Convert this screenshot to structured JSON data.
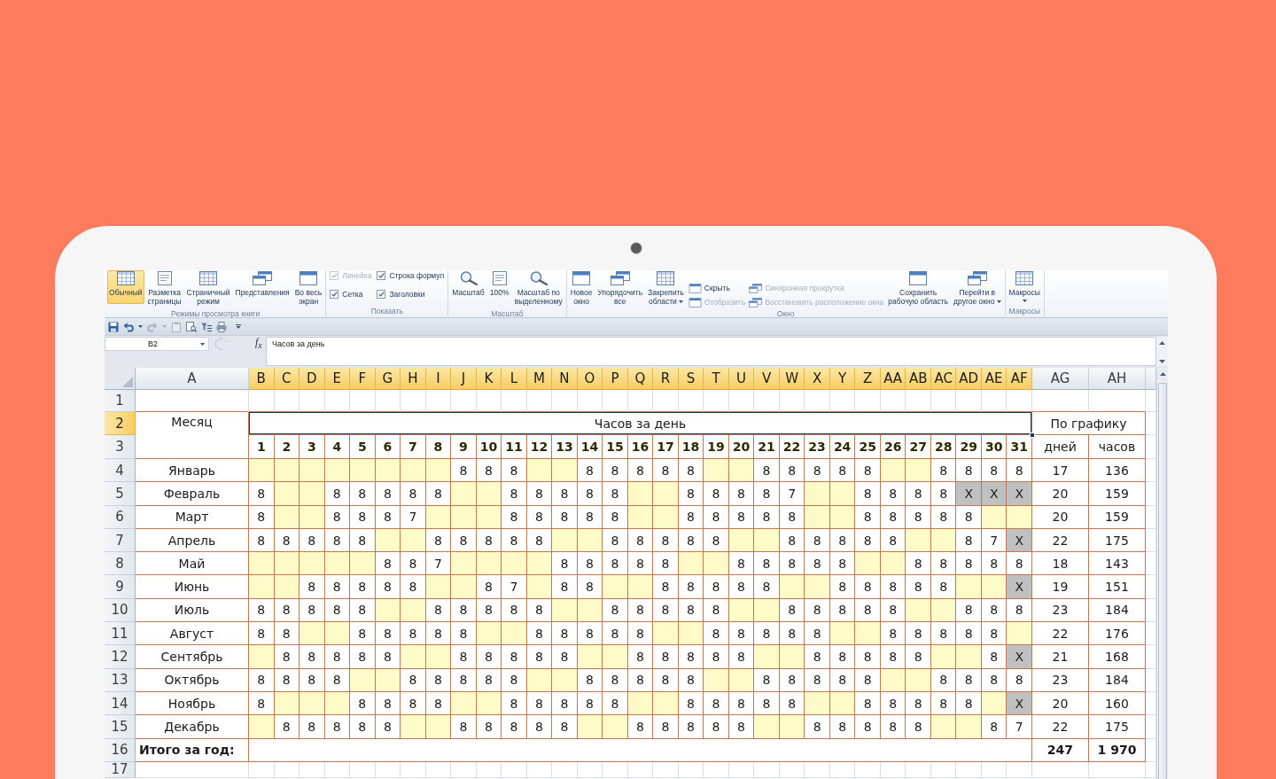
{
  "ribbon": {
    "groups": [
      {
        "label": "Режимы просмотра книги",
        "items": [
          {
            "kind": "large",
            "label": "Обычный",
            "selected": true,
            "disabled": false,
            "menu": false
          },
          {
            "kind": "large",
            "label": "Разметка\nстраницы",
            "selected": false,
            "disabled": false,
            "menu": false
          },
          {
            "kind": "large",
            "label": "Страничный\nрежим",
            "selected": false,
            "disabled": false,
            "menu": false
          },
          {
            "kind": "large",
            "label": "Представления",
            "selected": false,
            "disabled": false,
            "menu": false
          },
          {
            "kind": "large",
            "label": "Во весь\nэкран",
            "selected": false,
            "disabled": false,
            "menu": false
          }
        ]
      },
      {
        "label": "Показать",
        "items": [
          {
            "kind": "check",
            "label": "Линейка",
            "checked": true,
            "disabled": true
          },
          {
            "kind": "check",
            "label": "Сетка",
            "checked": true,
            "disabled": false
          },
          {
            "kind": "check",
            "label": "Строка формул",
            "checked": true,
            "disabled": false
          },
          {
            "kind": "check",
            "label": "Заголовки",
            "checked": true,
            "disabled": false
          }
        ]
      },
      {
        "label": "Масштаб",
        "items": [
          {
            "kind": "large",
            "label": "Масштаб",
            "disabled": false,
            "menu": false
          },
          {
            "kind": "large",
            "label": "100%",
            "disabled": false,
            "menu": false
          },
          {
            "kind": "large",
            "label": "Масштаб по\nвыделенному",
            "disabled": false,
            "menu": false
          }
        ]
      },
      {
        "label": "Окно",
        "items": [
          {
            "kind": "large",
            "label": "Новое\nокно",
            "disabled": false,
            "menu": false
          },
          {
            "kind": "large",
            "label": "Упорядочить\nвсе",
            "disabled": false,
            "menu": false
          },
          {
            "kind": "large",
            "label": "Закрепить\nобласти",
            "disabled": false,
            "menu": true
          },
          {
            "kind": "small",
            "label": "Скрыть",
            "disabled": false
          },
          {
            "kind": "small",
            "label": "Отобразить",
            "disabled": true
          },
          {
            "kind": "small",
            "label": "Синхронная прокрутка",
            "disabled": true
          },
          {
            "kind": "small",
            "label": "Восстановить расположение окна",
            "disabled": true
          },
          {
            "kind": "large",
            "label": "Сохранить\nрабочую область",
            "disabled": false,
            "menu": false
          },
          {
            "kind": "large",
            "label": "Перейти в\nдругое окно",
            "disabled": false,
            "menu": true
          }
        ]
      },
      {
        "label": "Макросы",
        "items": [
          {
            "kind": "large",
            "label": "Макросы",
            "disabled": false,
            "menu": true
          }
        ]
      }
    ]
  },
  "formula_bar": {
    "name_box": "B2",
    "function_button": "f$_{x}$",
    "formula": "Часов за день"
  },
  "sheet": {
    "columns": [
      {
        "label": "A",
        "selected": false
      },
      {
        "label": "B",
        "selected": true
      },
      {
        "label": "C",
        "selected": true
      },
      {
        "label": "D",
        "selected": true
      },
      {
        "label": "E",
        "selected": true
      },
      {
        "label": "F",
        "selected": true
      },
      {
        "label": "G",
        "selected": true
      },
      {
        "label": "H",
        "selected": true
      },
      {
        "label": "I",
        "selected": true
      },
      {
        "label": "J",
        "selected": true
      },
      {
        "label": "K",
        "selected": true
      },
      {
        "label": "L",
        "selected": true
      },
      {
        "label": "M",
        "selected": true
      },
      {
        "label": "N",
        "selected": true
      },
      {
        "label": "O",
        "selected": true
      },
      {
        "label": "P",
        "selected": true
      },
      {
        "label": "Q",
        "selected": true
      },
      {
        "label": "R",
        "selected": true
      },
      {
        "label": "S",
        "selected": true
      },
      {
        "label": "T",
        "selected": true
      },
      {
        "label": "U",
        "selected": true
      },
      {
        "label": "V",
        "selected": true
      },
      {
        "label": "W",
        "selected": true
      },
      {
        "label": "X",
        "selected": true
      },
      {
        "label": "Y",
        "selected": true
      },
      {
        "label": "Z",
        "selected": true
      },
      {
        "label": "AA",
        "selected": true
      },
      {
        "label": "AB",
        "selected": true
      },
      {
        "label": "AC",
        "selected": true
      },
      {
        "label": "AD",
        "selected": true
      },
      {
        "label": "AE",
        "selected": true
      },
      {
        "label": "AF",
        "selected": true
      },
      {
        "label": "AG",
        "selected": false
      },
      {
        "label": "AH",
        "selected": false
      }
    ],
    "rows": [
      {
        "label": "1",
        "selected": false
      },
      {
        "label": "2",
        "selected": true
      },
      {
        "label": "3",
        "selected": false
      },
      {
        "label": "4",
        "selected": false
      },
      {
        "label": "5",
        "selected": false
      },
      {
        "label": "6",
        "selected": false
      },
      {
        "label": "7",
        "selected": false
      },
      {
        "label": "8",
        "selected": false
      },
      {
        "label": "9",
        "selected": false
      },
      {
        "label": "10",
        "selected": false
      },
      {
        "label": "11",
        "selected": false
      },
      {
        "label": "12",
        "selected": false
      },
      {
        "label": "13",
        "selected": false
      },
      {
        "label": "14",
        "selected": false
      },
      {
        "label": "15",
        "selected": false
      },
      {
        "label": "16",
        "selected": false
      },
      {
        "label": "17",
        "selected": false
      }
    ],
    "title_cells": [
      {
        "text": "Месяц",
        "selected": false
      },
      {
        "text": "Часов за день",
        "selected": true
      },
      {
        "text": "По графику",
        "selected": false
      }
    ],
    "day_numbers": [
      "1",
      "2",
      "3",
      "4",
      "5",
      "6",
      "7",
      "8",
      "9",
      "10",
      "11",
      "12",
      "13",
      "14",
      "15",
      "16",
      "17",
      "18",
      "19",
      "20",
      "21",
      "22",
      "23",
      "24",
      "25",
      "26",
      "27",
      "28",
      "29",
      "30",
      "31"
    ],
    "schedule_columns": [
      "дней",
      "часов"
    ],
    "months": [
      {
        "name": "Январь",
        "days_total": "17",
        "hours_total": "136",
        "days": [
          {
            "kind": "weekend"
          },
          {
            "kind": "weekend"
          },
          {
            "kind": "weekend"
          },
          {
            "kind": "weekend"
          },
          {
            "kind": "weekend"
          },
          {
            "kind": "weekend"
          },
          {
            "kind": "weekend"
          },
          {
            "kind": "weekend"
          },
          {
            "kind": "work",
            "value": "8"
          },
          {
            "kind": "work",
            "value": "8"
          },
          {
            "kind": "work",
            "value": "8"
          },
          {
            "kind": "weekend"
          },
          {
            "kind": "weekend"
          },
          {
            "kind": "work",
            "value": "8"
          },
          {
            "kind": "work",
            "value": "8"
          },
          {
            "kind": "work",
            "value": "8"
          },
          {
            "kind": "work",
            "value": "8"
          },
          {
            "kind": "work",
            "value": "8"
          },
          {
            "kind": "weekend"
          },
          {
            "kind": "weekend"
          },
          {
            "kind": "work",
            "value": "8"
          },
          {
            "kind": "work",
            "value": "8"
          },
          {
            "kind": "work",
            "value": "8"
          },
          {
            "kind": "work",
            "value": "8"
          },
          {
            "kind": "work",
            "value": "8"
          },
          {
            "kind": "weekend"
          },
          {
            "kind": "weekend"
          },
          {
            "kind": "work",
            "value": "8"
          },
          {
            "kind": "work",
            "value": "8"
          },
          {
            "kind": "work",
            "value": "8"
          },
          {
            "kind": "work",
            "value": "8"
          }
        ]
      },
      {
        "name": "Февраль",
        "days_total": "20",
        "hours_total": "159",
        "days": [
          {
            "kind": "work",
            "value": "8"
          },
          {
            "kind": "weekend"
          },
          {
            "kind": "weekend"
          },
          {
            "kind": "work",
            "value": "8"
          },
          {
            "kind": "work",
            "value": "8"
          },
          {
            "kind": "work",
            "value": "8"
          },
          {
            "kind": "work",
            "value": "8"
          },
          {
            "kind": "work",
            "value": "8"
          },
          {
            "kind": "weekend"
          },
          {
            "kind": "weekend"
          },
          {
            "kind": "work",
            "value": "8"
          },
          {
            "kind": "work",
            "value": "8"
          },
          {
            "kind": "work",
            "value": "8"
          },
          {
            "kind": "work",
            "value": "8"
          },
          {
            "kind": "work",
            "value": "8"
          },
          {
            "kind": "weekend"
          },
          {
            "kind": "weekend"
          },
          {
            "kind": "work",
            "value": "8"
          },
          {
            "kind": "work",
            "value": "8"
          },
          {
            "kind": "work",
            "value": "8"
          },
          {
            "kind": "work",
            "value": "8"
          },
          {
            "kind": "work",
            "value": "7"
          },
          {
            "kind": "weekend"
          },
          {
            "kind": "weekend"
          },
          {
            "kind": "work",
            "value": "8"
          },
          {
            "kind": "work",
            "value": "8"
          },
          {
            "kind": "work",
            "value": "8"
          },
          {
            "kind": "work",
            "value": "8"
          },
          {
            "kind": "void",
            "value": "X"
          },
          {
            "kind": "void",
            "value": "X"
          },
          {
            "kind": "void",
            "value": "X"
          }
        ]
      },
      {
        "name": "Март",
        "days_total": "20",
        "hours_total": "159",
        "days": [
          {
            "kind": "work",
            "value": "8"
          },
          {
            "kind": "weekend"
          },
          {
            "kind": "weekend"
          },
          {
            "kind": "work",
            "value": "8"
          },
          {
            "kind": "work",
            "value": "8"
          },
          {
            "kind": "work",
            "value": "8"
          },
          {
            "kind": "work",
            "value": "7"
          },
          {
            "kind": "weekend"
          },
          {
            "kind": "weekend"
          },
          {
            "kind": "weekend"
          },
          {
            "kind": "work",
            "value": "8"
          },
          {
            "kind": "work",
            "value": "8"
          },
          {
            "kind": "work",
            "value": "8"
          },
          {
            "kind": "work",
            "value": "8"
          },
          {
            "kind": "work",
            "value": "8"
          },
          {
            "kind": "weekend"
          },
          {
            "kind": "weekend"
          },
          {
            "kind": "work",
            "value": "8"
          },
          {
            "kind": "work",
            "value": "8"
          },
          {
            "kind": "work",
            "value": "8"
          },
          {
            "kind": "work",
            "value": "8"
          },
          {
            "kind": "work",
            "value": "8"
          },
          {
            "kind": "weekend"
          },
          {
            "kind": "weekend"
          },
          {
            "kind": "work",
            "value": "8"
          },
          {
            "kind": "work",
            "value": "8"
          },
          {
            "kind": "work",
            "value": "8"
          },
          {
            "kind": "work",
            "value": "8"
          },
          {
            "kind": "work",
            "value": "8"
          },
          {
            "kind": "weekend"
          },
          {
            "kind": "weekend"
          }
        ]
      },
      {
        "name": "Апрель",
        "days_total": "22",
        "hours_total": "175",
        "days": [
          {
            "kind": "work",
            "value": "8"
          },
          {
            "kind": "work",
            "value": "8"
          },
          {
            "kind": "work",
            "value": "8"
          },
          {
            "kind": "work",
            "value": "8"
          },
          {
            "kind": "work",
            "value": "8"
          },
          {
            "kind": "weekend"
          },
          {
            "kind": "weekend"
          },
          {
            "kind": "work",
            "value": "8"
          },
          {
            "kind": "work",
            "value": "8"
          },
          {
            "kind": "work",
            "value": "8"
          },
          {
            "kind": "work",
            "value": "8"
          },
          {
            "kind": "work",
            "value": "8"
          },
          {
            "kind": "weekend"
          },
          {
            "kind": "weekend"
          },
          {
            "kind": "work",
            "value": "8"
          },
          {
            "kind": "work",
            "value": "8"
          },
          {
            "kind": "work",
            "value": "8"
          },
          {
            "kind": "work",
            "value": "8"
          },
          {
            "kind": "work",
            "value": "8"
          },
          {
            "kind": "weekend"
          },
          {
            "kind": "weekend"
          },
          {
            "kind": "work",
            "value": "8"
          },
          {
            "kind": "work",
            "value": "8"
          },
          {
            "kind": "work",
            "value": "8"
          },
          {
            "kind": "work",
            "value": "8"
          },
          {
            "kind": "work",
            "value": "8"
          },
          {
            "kind": "weekend"
          },
          {
            "kind": "weekend"
          },
          {
            "kind": "work",
            "value": "8"
          },
          {
            "kind": "work",
            "value": "7"
          },
          {
            "kind": "void",
            "value": "X"
          }
        ]
      },
      {
        "name": "Май",
        "days_total": "18",
        "hours_total": "143",
        "days": [
          {
            "kind": "weekend"
          },
          {
            "kind": "weekend"
          },
          {
            "kind": "weekend"
          },
          {
            "kind": "weekend"
          },
          {
            "kind": "weekend"
          },
          {
            "kind": "work",
            "value": "8"
          },
          {
            "kind": "work",
            "value": "8"
          },
          {
            "kind": "work",
            "value": "7"
          },
          {
            "kind": "weekend"
          },
          {
            "kind": "weekend"
          },
          {
            "kind": "weekend"
          },
          {
            "kind": "weekend"
          },
          {
            "kind": "work",
            "value": "8"
          },
          {
            "kind": "work",
            "value": "8"
          },
          {
            "kind": "work",
            "value": "8"
          },
          {
            "kind": "work",
            "value": "8"
          },
          {
            "kind": "work",
            "value": "8"
          },
          {
            "kind": "weekend"
          },
          {
            "kind": "weekend"
          },
          {
            "kind": "work",
            "value": "8"
          },
          {
            "kind": "work",
            "value": "8"
          },
          {
            "kind": "work",
            "value": "8"
          },
          {
            "kind": "work",
            "value": "8"
          },
          {
            "kind": "work",
            "value": "8"
          },
          {
            "kind": "weekend"
          },
          {
            "kind": "weekend"
          },
          {
            "kind": "work",
            "value": "8"
          },
          {
            "kind": "work",
            "value": "8"
          },
          {
            "kind": "work",
            "value": "8"
          },
          {
            "kind": "work",
            "value": "8"
          },
          {
            "kind": "work",
            "value": "8"
          }
        ]
      },
      {
        "name": "Июнь",
        "days_total": "19",
        "hours_total": "151",
        "days": [
          {
            "kind": "weekend"
          },
          {
            "kind": "weekend"
          },
          {
            "kind": "work",
            "value": "8"
          },
          {
            "kind": "work",
            "value": "8"
          },
          {
            "kind": "work",
            "value": "8"
          },
          {
            "kind": "work",
            "value": "8"
          },
          {
            "kind": "work",
            "value": "8"
          },
          {
            "kind": "weekend"
          },
          {
            "kind": "weekend"
          },
          {
            "kind": "work",
            "value": "8"
          },
          {
            "kind": "work",
            "value": "7"
          },
          {
            "kind": "weekend"
          },
          {
            "kind": "work",
            "value": "8"
          },
          {
            "kind": "work",
            "value": "8"
          },
          {
            "kind": "weekend"
          },
          {
            "kind": "weekend"
          },
          {
            "kind": "work",
            "value": "8"
          },
          {
            "kind": "work",
            "value": "8"
          },
          {
            "kind": "work",
            "value": "8"
          },
          {
            "kind": "work",
            "value": "8"
          },
          {
            "kind": "work",
            "value": "8"
          },
          {
            "kind": "weekend"
          },
          {
            "kind": "weekend"
          },
          {
            "kind": "work",
            "value": "8"
          },
          {
            "kind": "work",
            "value": "8"
          },
          {
            "kind": "work",
            "value": "8"
          },
          {
            "kind": "work",
            "value": "8"
          },
          {
            "kind": "work",
            "value": "8"
          },
          {
            "kind": "weekend"
          },
          {
            "kind": "weekend"
          },
          {
            "kind": "void",
            "value": "X"
          }
        ]
      },
      {
        "name": "Июль",
        "days_total": "23",
        "hours_total": "184",
        "days": [
          {
            "kind": "work",
            "value": "8"
          },
          {
            "kind": "work",
            "value": "8"
          },
          {
            "kind": "work",
            "value": "8"
          },
          {
            "kind": "work",
            "value": "8"
          },
          {
            "kind": "work",
            "value": "8"
          },
          {
            "kind": "weekend"
          },
          {
            "kind": "weekend"
          },
          {
            "kind": "work",
            "value": "8"
          },
          {
            "kind": "work",
            "value": "8"
          },
          {
            "kind": "work",
            "value": "8"
          },
          {
            "kind": "work",
            "value": "8"
          },
          {
            "kind": "work",
            "value": "8"
          },
          {
            "kind": "weekend"
          },
          {
            "kind": "weekend"
          },
          {
            "kind": "work",
            "value": "8"
          },
          {
            "kind": "work",
            "value": "8"
          },
          {
            "kind": "work",
            "value": "8"
          },
          {
            "kind": "work",
            "value": "8"
          },
          {
            "kind": "work",
            "value": "8"
          },
          {
            "kind": "weekend"
          },
          {
            "kind": "weekend"
          },
          {
            "kind": "work",
            "value": "8"
          },
          {
            "kind": "work",
            "value": "8"
          },
          {
            "kind": "work",
            "value": "8"
          },
          {
            "kind": "work",
            "value": "8"
          },
          {
            "kind": "work",
            "value": "8"
          },
          {
            "kind": "weekend"
          },
          {
            "kind": "weekend"
          },
          {
            "kind": "work",
            "value": "8"
          },
          {
            "kind": "work",
            "value": "8"
          },
          {
            "kind": "work",
            "value": "8"
          }
        ]
      },
      {
        "name": "Август",
        "days_total": "22",
        "hours_total": "176",
        "days": [
          {
            "kind": "work",
            "value": "8"
          },
          {
            "kind": "work",
            "value": "8"
          },
          {
            "kind": "weekend"
          },
          {
            "kind": "weekend"
          },
          {
            "kind": "work",
            "value": "8"
          },
          {
            "kind": "work",
            "value": "8"
          },
          {
            "kind": "work",
            "value": "8"
          },
          {
            "kind": "work",
            "value": "8"
          },
          {
            "kind": "work",
            "value": "8"
          },
          {
            "kind": "weekend"
          },
          {
            "kind": "weekend"
          },
          {
            "kind": "work",
            "value": "8"
          },
          {
            "kind": "work",
            "value": "8"
          },
          {
            "kind": "work",
            "value": "8"
          },
          {
            "kind": "work",
            "value": "8"
          },
          {
            "kind": "work",
            "value": "8"
          },
          {
            "kind": "weekend"
          },
          {
            "kind": "weekend"
          },
          {
            "kind": "work",
            "value": "8"
          },
          {
            "kind": "work",
            "value": "8"
          },
          {
            "kind": "work",
            "value": "8"
          },
          {
            "kind": "work",
            "value": "8"
          },
          {
            "kind": "work",
            "value": "8"
          },
          {
            "kind": "weekend"
          },
          {
            "kind": "weekend"
          },
          {
            "kind": "work",
            "value": "8"
          },
          {
            "kind": "work",
            "value": "8"
          },
          {
            "kind": "work",
            "value": "8"
          },
          {
            "kind": "work",
            "value": "8"
          },
          {
            "kind": "work",
            "value": "8"
          },
          {
            "kind": "weekend"
          }
        ]
      },
      {
        "name": "Сентябрь",
        "days_total": "21",
        "hours_total": "168",
        "days": [
          {
            "kind": "weekend"
          },
          {
            "kind": "work",
            "value": "8"
          },
          {
            "kind": "work",
            "value": "8"
          },
          {
            "kind": "work",
            "value": "8"
          },
          {
            "kind": "work",
            "value": "8"
          },
          {
            "kind": "work",
            "value": "8"
          },
          {
            "kind": "weekend"
          },
          {
            "kind": "weekend"
          },
          {
            "kind": "work",
            "value": "8"
          },
          {
            "kind": "work",
            "value": "8"
          },
          {
            "kind": "work",
            "value": "8"
          },
          {
            "kind": "work",
            "value": "8"
          },
          {
            "kind": "work",
            "value": "8"
          },
          {
            "kind": "weekend"
          },
          {
            "kind": "weekend"
          },
          {
            "kind": "work",
            "value": "8"
          },
          {
            "kind": "work",
            "value": "8"
          },
          {
            "kind": "work",
            "value": "8"
          },
          {
            "kind": "work",
            "value": "8"
          },
          {
            "kind": "work",
            "value": "8"
          },
          {
            "kind": "weekend"
          },
          {
            "kind": "weekend"
          },
          {
            "kind": "work",
            "value": "8"
          },
          {
            "kind": "work",
            "value": "8"
          },
          {
            "kind": "work",
            "value": "8"
          },
          {
            "kind": "work",
            "value": "8"
          },
          {
            "kind": "work",
            "value": "8"
          },
          {
            "kind": "weekend"
          },
          {
            "kind": "weekend"
          },
          {
            "kind": "work",
            "value": "8"
          },
          {
            "kind": "void",
            "value": "X"
          }
        ]
      },
      {
        "name": "Октябрь",
        "days_total": "23",
        "hours_total": "184",
        "days": [
          {
            "kind": "work",
            "value": "8"
          },
          {
            "kind": "work",
            "value": "8"
          },
          {
            "kind": "work",
            "value": "8"
          },
          {
            "kind": "work",
            "value": "8"
          },
          {
            "kind": "weekend"
          },
          {
            "kind": "weekend"
          },
          {
            "kind": "work",
            "value": "8"
          },
          {
            "kind": "work",
            "value": "8"
          },
          {
            "kind": "work",
            "value": "8"
          },
          {
            "kind": "work",
            "value": "8"
          },
          {
            "kind": "work",
            "value": "8"
          },
          {
            "kind": "weekend"
          },
          {
            "kind": "weekend"
          },
          {
            "kind": "work",
            "value": "8"
          },
          {
            "kind": "work",
            "value": "8"
          },
          {
            "kind": "work",
            "value": "8"
          },
          {
            "kind": "work",
            "value": "8"
          },
          {
            "kind": "work",
            "value": "8"
          },
          {
            "kind": "weekend"
          },
          {
            "kind": "weekend"
          },
          {
            "kind": "work",
            "value": "8"
          },
          {
            "kind": "work",
            "value": "8"
          },
          {
            "kind": "work",
            "value": "8"
          },
          {
            "kind": "work",
            "value": "8"
          },
          {
            "kind": "work",
            "value": "8"
          },
          {
            "kind": "weekend"
          },
          {
            "kind": "weekend"
          },
          {
            "kind": "work",
            "value": "8"
          },
          {
            "kind": "work",
            "value": "8"
          },
          {
            "kind": "work",
            "value": "8"
          },
          {
            "kind": "work",
            "value": "8"
          }
        ]
      },
      {
        "name": "Ноябрь",
        "days_total": "20",
        "hours_total": "160",
        "days": [
          {
            "kind": "work",
            "value": "8"
          },
          {
            "kind": "weekend"
          },
          {
            "kind": "weekend"
          },
          {
            "kind": "weekend"
          },
          {
            "kind": "work",
            "value": "8"
          },
          {
            "kind": "work",
            "value": "8"
          },
          {
            "kind": "work",
            "value": "8"
          },
          {
            "kind": "work",
            "value": "8"
          },
          {
            "kind": "weekend"
          },
          {
            "kind": "weekend"
          },
          {
            "kind": "work",
            "value": "8"
          },
          {
            "kind": "work",
            "value": "8"
          },
          {
            "kind": "work",
            "value": "8"
          },
          {
            "kind": "work",
            "value": "8"
          },
          {
            "kind": "work",
            "value": "8"
          },
          {
            "kind": "weekend"
          },
          {
            "kind": "weekend"
          },
          {
            "kind": "work",
            "value": "8"
          },
          {
            "kind": "work",
            "value": "8"
          },
          {
            "kind": "work",
            "value": "8"
          },
          {
            "kind": "work",
            "value": "8"
          },
          {
            "kind": "work",
            "value": "8"
          },
          {
            "kind": "weekend"
          },
          {
            "kind": "weekend"
          },
          {
            "kind": "work",
            "value": "8"
          },
          {
            "kind": "work",
            "value": "8"
          },
          {
            "kind": "work",
            "value": "8"
          },
          {
            "kind": "work",
            "value": "8"
          },
          {
            "kind": "work",
            "value": "8"
          },
          {
            "kind": "weekend"
          },
          {
            "kind": "void",
            "value": "X"
          }
        ]
      },
      {
        "name": "Декабрь",
        "days_total": "22",
        "hours_total": "175",
        "days": [
          {
            "kind": "weekend"
          },
          {
            "kind": "work",
            "value": "8"
          },
          {
            "kind": "work",
            "value": "8"
          },
          {
            "kind": "work",
            "value": "8"
          },
          {
            "kind": "work",
            "value": "8"
          },
          {
            "kind": "work",
            "value": "8"
          },
          {
            "kind": "weekend"
          },
          {
            "kind": "weekend"
          },
          {
            "kind": "work",
            "value": "8"
          },
          {
            "kind": "work",
            "value": "8"
          },
          {
            "kind": "work",
            "value": "8"
          },
          {
            "kind": "work",
            "value": "8"
          },
          {
            "kind": "work",
            "value": "8"
          },
          {
            "kind": "weekend"
          },
          {
            "kind": "weekend"
          },
          {
            "kind": "work",
            "value": "8"
          },
          {
            "kind": "work",
            "value": "8"
          },
          {
            "kind": "work",
            "value": "8"
          },
          {
            "kind": "work",
            "value": "8"
          },
          {
            "kind": "work",
            "value": "8"
          },
          {
            "kind": "weekend"
          },
          {
            "kind": "weekend"
          },
          {
            "kind": "work",
            "value": "8"
          },
          {
            "kind": "work",
            "value": "8"
          },
          {
            "kind": "work",
            "value": "8"
          },
          {
            "kind": "work",
            "value": "8"
          },
          {
            "kind": "work",
            "value": "8"
          },
          {
            "kind": "weekend"
          },
          {
            "kind": "weekend"
          },
          {
            "kind": "work",
            "value": "8"
          },
          {
            "kind": "work",
            "value": "7"
          }
        ]
      }
    ],
    "total": {
      "label": "Итого за год:",
      "days": "247",
      "hours": "1 970"
    }
  }
}
